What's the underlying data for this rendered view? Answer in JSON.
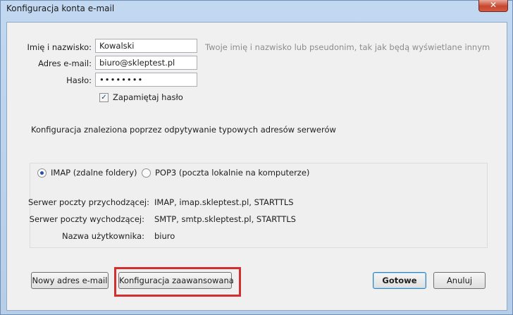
{
  "window": {
    "title": "Konfiguracja konta e-mail",
    "close_glyph": "✕"
  },
  "form": {
    "name_label": "Imię i nazwisko:",
    "name_value": "Kowalski",
    "name_hint": "Twoje imię i nazwisko lub pseudonim, tak jak będą wyświetlane innym",
    "email_label": "Adres e-mail:",
    "email_value": "biuro@skleptest.pl",
    "password_label": "Hasło:",
    "password_value": "••••••••",
    "remember_label": "Zapamiętaj hasło",
    "remember_checked": true
  },
  "status_text": "Konfiguracja znaleziona poprzez odpytywanie typowych adresów serwerów",
  "protocol": {
    "imap_label": "IMAP (zdalne foldery)",
    "pop3_label": "POP3 (poczta lokalnie na komputerze)",
    "selected": "IMAP"
  },
  "servers": {
    "incoming_label": "Serwer poczty przychodzącej:",
    "incoming_value": "IMAP, imap.skleptest.pl, STARTTLS",
    "outgoing_label": "Serwer poczty wychodzącej:",
    "outgoing_value": "SMTP, smtp.skleptest.pl, STARTTLS",
    "username_label": "Nazwa użytkownika:",
    "username_value": "biuro"
  },
  "buttons": {
    "new_account": "Nowy adres e-mail",
    "advanced": "Konfiguracja zaawansowana",
    "done": "Gotowe",
    "cancel": "Anuluj"
  },
  "colors": {
    "highlight": "#d32f2f",
    "accent": "#1f55a3"
  }
}
